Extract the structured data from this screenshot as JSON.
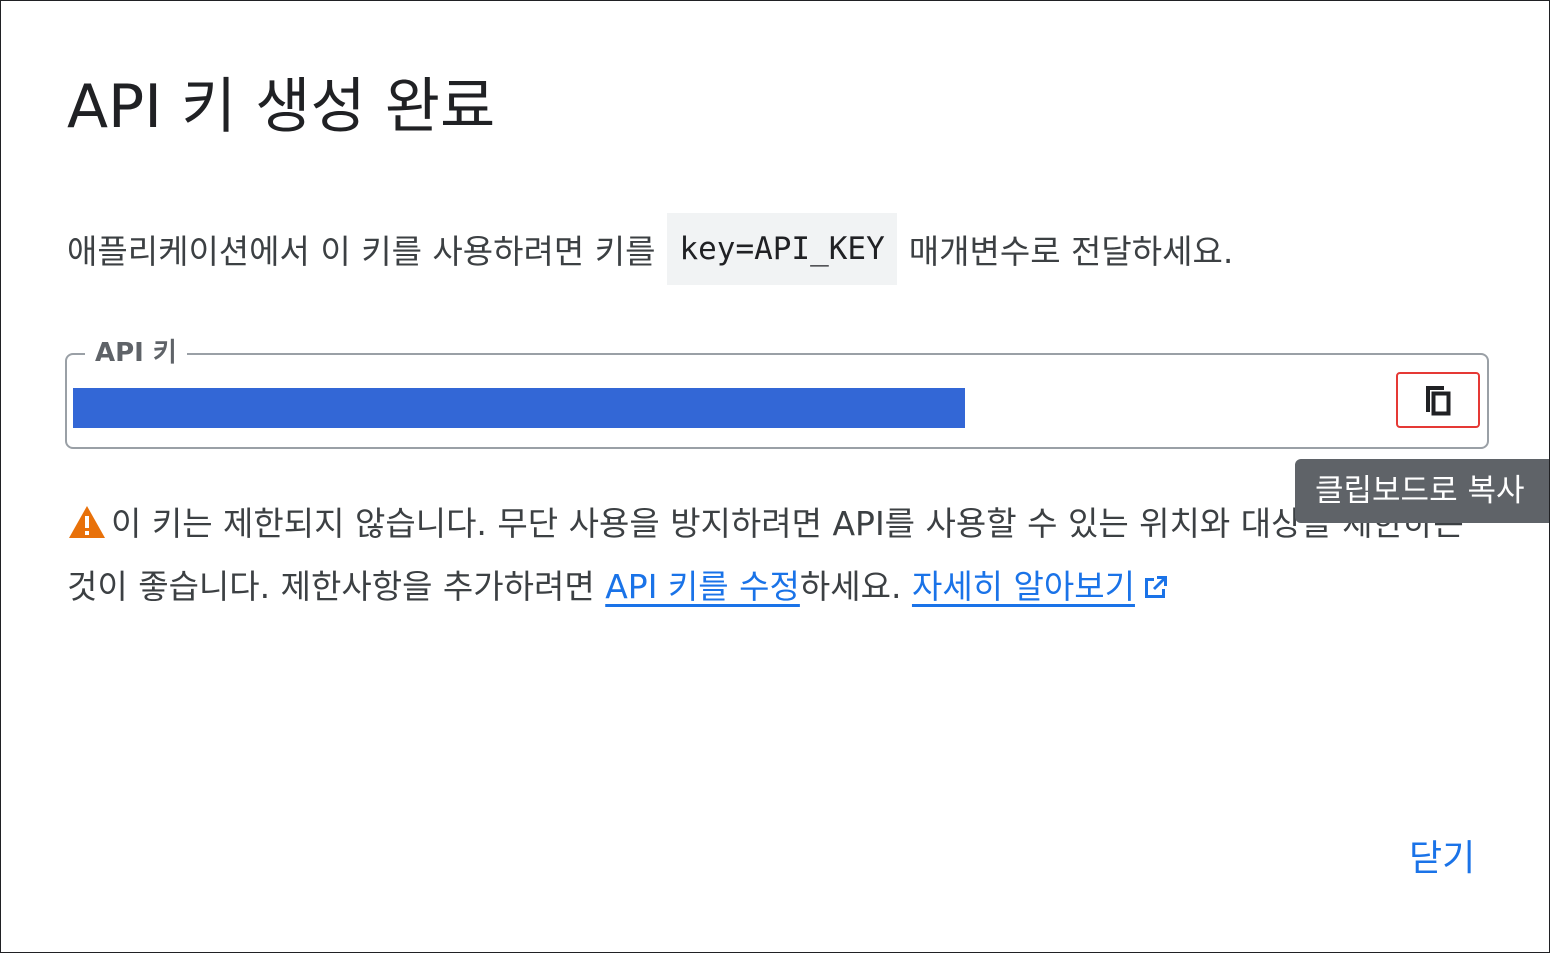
{
  "dialog": {
    "title": "API 키 생성 완료",
    "intro": {
      "before": "애플리케이션에서 이 키를 사용하려면 키를",
      "code": "key=API_KEY",
      "after": "매개변수로 전달하세요."
    },
    "key_field": {
      "label": "API 키",
      "value": "",
      "value_redacted": true
    },
    "copy_button": {
      "icon": "copy-icon",
      "tooltip": "클립보드로 복사"
    },
    "warning": {
      "icon": "warning-icon",
      "text": "이 키는 제한되지 않습니다. 무단 사용을 방지하려면 API를 사용할 수 있는 위치와 대상을 제한하는 것이 좋습니다. 제한사항을 추가하려면",
      "edit_link": "API 키를 수정",
      "text_after": "하세요.",
      "learn_more_link": "자세히 알아보기",
      "learn_more_icon": "open-in-new-icon"
    },
    "close_button": "닫기"
  },
  "colors": {
    "accent": "#1a73e8",
    "redaction": "#3367d6",
    "warning_icon": "#e8710a",
    "tooltip_bg": "#5f6368",
    "copy_highlight": "#e53935"
  }
}
